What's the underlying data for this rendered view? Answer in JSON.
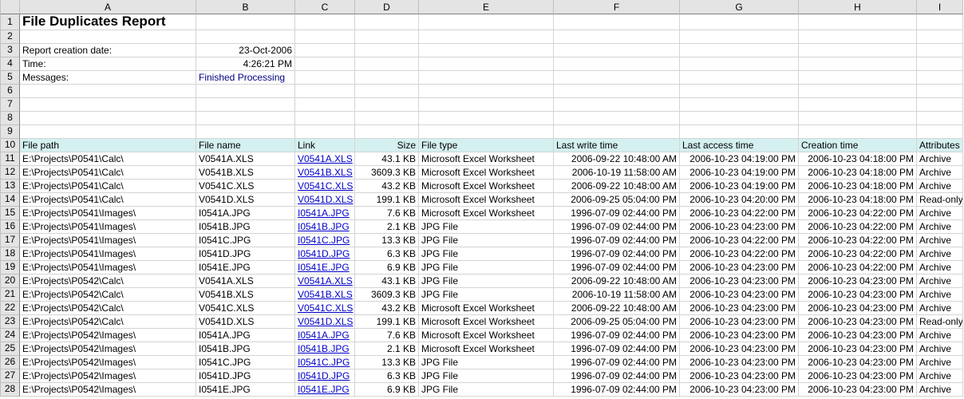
{
  "columns": [
    "A",
    "B",
    "C",
    "D",
    "E",
    "F",
    "G",
    "H",
    "I"
  ],
  "title": "File Duplicates Report",
  "meta": {
    "report_date_label": "Report creation date:",
    "report_date_value": "23-Oct-2006",
    "time_label": "Time:",
    "time_value": "4:26:21 PM",
    "messages_label": "Messages:",
    "messages_value": "Finished Processing"
  },
  "table_headers": {
    "A": "File path",
    "B": "File name",
    "C": "Link",
    "D": "Size",
    "E": "File type",
    "F": "Last write time",
    "G": "Last access time",
    "H": "Creation time",
    "I": "Attributes"
  },
  "rows": [
    {
      "n": 11,
      "path": "E:\\Projects\\P0541\\Calc\\",
      "name": "V0541A.XLS",
      "link": "V0541A.XLS",
      "size": "43.1 KB",
      "type": "Microsoft Excel Worksheet",
      "lwt": "2006-09-22 10:48:00 AM",
      "lat": "2006-10-23 04:19:00 PM",
      "ct": "2006-10-23 04:18:00 PM",
      "attr": "Archive"
    },
    {
      "n": 12,
      "path": "E:\\Projects\\P0541\\Calc\\",
      "name": "V0541B.XLS",
      "link": "V0541B.XLS",
      "size": "3609.3 KB",
      "type": "Microsoft Excel Worksheet",
      "lwt": "2006-10-19 11:58:00 AM",
      "lat": "2006-10-23 04:19:00 PM",
      "ct": "2006-10-23 04:18:00 PM",
      "attr": "Archive"
    },
    {
      "n": 13,
      "path": "E:\\Projects\\P0541\\Calc\\",
      "name": "V0541C.XLS",
      "link": "V0541C.XLS",
      "size": "43.2 KB",
      "type": "Microsoft Excel Worksheet",
      "lwt": "2006-09-22 10:48:00 AM",
      "lat": "2006-10-23 04:19:00 PM",
      "ct": "2006-10-23 04:18:00 PM",
      "attr": "Archive"
    },
    {
      "n": 14,
      "path": "E:\\Projects\\P0541\\Calc\\",
      "name": "V0541D.XLS",
      "link": "V0541D.XLS",
      "size": "199.1 KB",
      "type": "Microsoft Excel Worksheet",
      "lwt": "2006-09-25 05:04:00 PM",
      "lat": "2006-10-23 04:20:00 PM",
      "ct": "2006-10-23 04:18:00 PM",
      "attr": "Read-only"
    },
    {
      "n": 15,
      "path": "E:\\Projects\\P0541\\Images\\",
      "name": "I0541A.JPG",
      "link": "I0541A.JPG",
      "size": "7.6 KB",
      "type": "Microsoft Excel Worksheet",
      "lwt": "1996-07-09 02:44:00 PM",
      "lat": "2006-10-23 04:22:00 PM",
      "ct": "2006-10-23 04:22:00 PM",
      "attr": "Archive"
    },
    {
      "n": 16,
      "path": "E:\\Projects\\P0541\\Images\\",
      "name": "I0541B.JPG",
      "link": "I0541B.JPG",
      "size": "2.1 KB",
      "type": "JPG File",
      "lwt": "1996-07-09 02:44:00 PM",
      "lat": "2006-10-23 04:23:00 PM",
      "ct": "2006-10-23 04:22:00 PM",
      "attr": "Archive"
    },
    {
      "n": 17,
      "path": "E:\\Projects\\P0541\\Images\\",
      "name": "I0541C.JPG",
      "link": "I0541C.JPG",
      "size": "13.3 KB",
      "type": "JPG File",
      "lwt": "1996-07-09 02:44:00 PM",
      "lat": "2006-10-23 04:22:00 PM",
      "ct": "2006-10-23 04:22:00 PM",
      "attr": "Archive"
    },
    {
      "n": 18,
      "path": "E:\\Projects\\P0541\\Images\\",
      "name": "I0541D.JPG",
      "link": "I0541D.JPG",
      "size": "6.3 KB",
      "type": "JPG File",
      "lwt": "1996-07-09 02:44:00 PM",
      "lat": "2006-10-23 04:22:00 PM",
      "ct": "2006-10-23 04:22:00 PM",
      "attr": "Archive"
    },
    {
      "n": 19,
      "path": "E:\\Projects\\P0541\\Images\\",
      "name": "I0541E.JPG",
      "link": "I0541E.JPG",
      "size": "6.9 KB",
      "type": "JPG File",
      "lwt": "1996-07-09 02:44:00 PM",
      "lat": "2006-10-23 04:23:00 PM",
      "ct": "2006-10-23 04:22:00 PM",
      "attr": "Archive"
    },
    {
      "n": 20,
      "path": "E:\\Projects\\P0542\\Calc\\",
      "name": "V0541A.XLS",
      "link": "V0541A.XLS",
      "size": "43.1 KB",
      "type": "JPG File",
      "lwt": "2006-09-22 10:48:00 AM",
      "lat": "2006-10-23 04:23:00 PM",
      "ct": "2006-10-23 04:23:00 PM",
      "attr": "Archive"
    },
    {
      "n": 21,
      "path": "E:\\Projects\\P0542\\Calc\\",
      "name": "V0541B.XLS",
      "link": "V0541B.XLS",
      "size": "3609.3 KB",
      "type": "JPG File",
      "lwt": "2006-10-19 11:58:00 AM",
      "lat": "2006-10-23 04:23:00 PM",
      "ct": "2006-10-23 04:23:00 PM",
      "attr": "Archive"
    },
    {
      "n": 22,
      "path": "E:\\Projects\\P0542\\Calc\\",
      "name": "V0541C.XLS",
      "link": "V0541C.XLS",
      "size": "43.2 KB",
      "type": "Microsoft Excel Worksheet",
      "lwt": "2006-09-22 10:48:00 AM",
      "lat": "2006-10-23 04:23:00 PM",
      "ct": "2006-10-23 04:23:00 PM",
      "attr": "Archive"
    },
    {
      "n": 23,
      "path": "E:\\Projects\\P0542\\Calc\\",
      "name": "V0541D.XLS",
      "link": "V0541D.XLS",
      "size": "199.1 KB",
      "type": "Microsoft Excel Worksheet",
      "lwt": "2006-09-25 05:04:00 PM",
      "lat": "2006-10-23 04:23:00 PM",
      "ct": "2006-10-23 04:23:00 PM",
      "attr": "Read-only"
    },
    {
      "n": 24,
      "path": "E:\\Projects\\P0542\\Images\\",
      "name": "I0541A.JPG",
      "link": "I0541A.JPG",
      "size": "7.6 KB",
      "type": "Microsoft Excel Worksheet",
      "lwt": "1996-07-09 02:44:00 PM",
      "lat": "2006-10-23 04:23:00 PM",
      "ct": "2006-10-23 04:23:00 PM",
      "attr": "Archive"
    },
    {
      "n": 25,
      "path": "E:\\Projects\\P0542\\Images\\",
      "name": "I0541B.JPG",
      "link": "I0541B.JPG",
      "size": "2.1 KB",
      "type": "Microsoft Excel Worksheet",
      "lwt": "1996-07-09 02:44:00 PM",
      "lat": "2006-10-23 04:23:00 PM",
      "ct": "2006-10-23 04:23:00 PM",
      "attr": "Archive"
    },
    {
      "n": 26,
      "path": "E:\\Projects\\P0542\\Images\\",
      "name": "I0541C.JPG",
      "link": "I0541C.JPG",
      "size": "13.3 KB",
      "type": "JPG File",
      "lwt": "1996-07-09 02:44:00 PM",
      "lat": "2006-10-23 04:23:00 PM",
      "ct": "2006-10-23 04:23:00 PM",
      "attr": "Archive"
    },
    {
      "n": 27,
      "path": "E:\\Projects\\P0542\\Images\\",
      "name": "I0541D.JPG",
      "link": "I0541D.JPG",
      "size": "6.3 KB",
      "type": "JPG File",
      "lwt": "1996-07-09 02:44:00 PM",
      "lat": "2006-10-23 04:23:00 PM",
      "ct": "2006-10-23 04:23:00 PM",
      "attr": "Archive"
    },
    {
      "n": 28,
      "path": "E:\\Projects\\P0542\\Images\\",
      "name": "I0541E.JPG",
      "link": "I0541E.JPG",
      "size": "6.9 KB",
      "type": "JPG File",
      "lwt": "1996-07-09 02:44:00 PM",
      "lat": "2006-10-23 04:23:00 PM",
      "ct": "2006-10-23 04:23:00 PM",
      "attr": "Archive"
    }
  ]
}
